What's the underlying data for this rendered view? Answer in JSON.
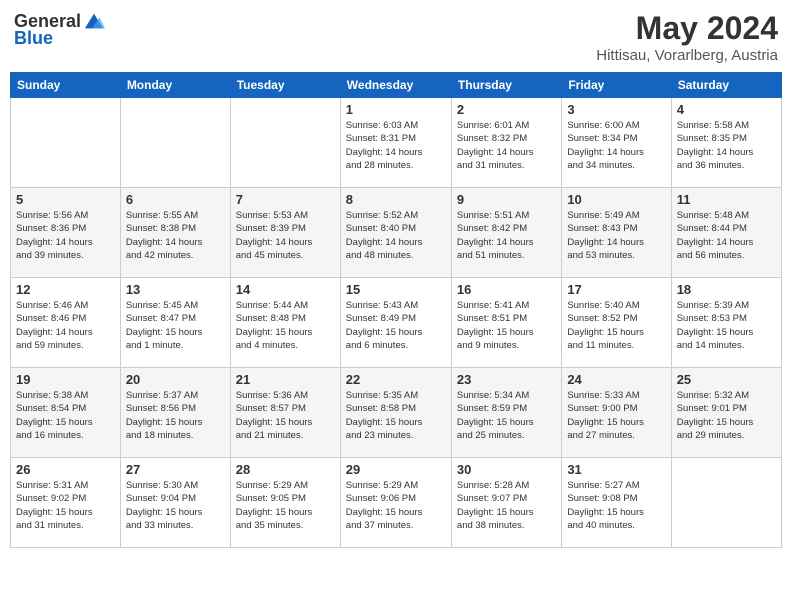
{
  "header": {
    "logo_line1": "General",
    "logo_line2": "Blue",
    "month_year": "May 2024",
    "location": "Hittisau, Vorarlberg, Austria"
  },
  "days_of_week": [
    "Sunday",
    "Monday",
    "Tuesday",
    "Wednesday",
    "Thursday",
    "Friday",
    "Saturday"
  ],
  "weeks": [
    [
      {
        "day": "",
        "info": ""
      },
      {
        "day": "",
        "info": ""
      },
      {
        "day": "",
        "info": ""
      },
      {
        "day": "1",
        "info": "Sunrise: 6:03 AM\nSunset: 8:31 PM\nDaylight: 14 hours\nand 28 minutes."
      },
      {
        "day": "2",
        "info": "Sunrise: 6:01 AM\nSunset: 8:32 PM\nDaylight: 14 hours\nand 31 minutes."
      },
      {
        "day": "3",
        "info": "Sunrise: 6:00 AM\nSunset: 8:34 PM\nDaylight: 14 hours\nand 34 minutes."
      },
      {
        "day": "4",
        "info": "Sunrise: 5:58 AM\nSunset: 8:35 PM\nDaylight: 14 hours\nand 36 minutes."
      }
    ],
    [
      {
        "day": "5",
        "info": "Sunrise: 5:56 AM\nSunset: 8:36 PM\nDaylight: 14 hours\nand 39 minutes."
      },
      {
        "day": "6",
        "info": "Sunrise: 5:55 AM\nSunset: 8:38 PM\nDaylight: 14 hours\nand 42 minutes."
      },
      {
        "day": "7",
        "info": "Sunrise: 5:53 AM\nSunset: 8:39 PM\nDaylight: 14 hours\nand 45 minutes."
      },
      {
        "day": "8",
        "info": "Sunrise: 5:52 AM\nSunset: 8:40 PM\nDaylight: 14 hours\nand 48 minutes."
      },
      {
        "day": "9",
        "info": "Sunrise: 5:51 AM\nSunset: 8:42 PM\nDaylight: 14 hours\nand 51 minutes."
      },
      {
        "day": "10",
        "info": "Sunrise: 5:49 AM\nSunset: 8:43 PM\nDaylight: 14 hours\nand 53 minutes."
      },
      {
        "day": "11",
        "info": "Sunrise: 5:48 AM\nSunset: 8:44 PM\nDaylight: 14 hours\nand 56 minutes."
      }
    ],
    [
      {
        "day": "12",
        "info": "Sunrise: 5:46 AM\nSunset: 8:46 PM\nDaylight: 14 hours\nand 59 minutes."
      },
      {
        "day": "13",
        "info": "Sunrise: 5:45 AM\nSunset: 8:47 PM\nDaylight: 15 hours\nand 1 minute."
      },
      {
        "day": "14",
        "info": "Sunrise: 5:44 AM\nSunset: 8:48 PM\nDaylight: 15 hours\nand 4 minutes."
      },
      {
        "day": "15",
        "info": "Sunrise: 5:43 AM\nSunset: 8:49 PM\nDaylight: 15 hours\nand 6 minutes."
      },
      {
        "day": "16",
        "info": "Sunrise: 5:41 AM\nSunset: 8:51 PM\nDaylight: 15 hours\nand 9 minutes."
      },
      {
        "day": "17",
        "info": "Sunrise: 5:40 AM\nSunset: 8:52 PM\nDaylight: 15 hours\nand 11 minutes."
      },
      {
        "day": "18",
        "info": "Sunrise: 5:39 AM\nSunset: 8:53 PM\nDaylight: 15 hours\nand 14 minutes."
      }
    ],
    [
      {
        "day": "19",
        "info": "Sunrise: 5:38 AM\nSunset: 8:54 PM\nDaylight: 15 hours\nand 16 minutes."
      },
      {
        "day": "20",
        "info": "Sunrise: 5:37 AM\nSunset: 8:56 PM\nDaylight: 15 hours\nand 18 minutes."
      },
      {
        "day": "21",
        "info": "Sunrise: 5:36 AM\nSunset: 8:57 PM\nDaylight: 15 hours\nand 21 minutes."
      },
      {
        "day": "22",
        "info": "Sunrise: 5:35 AM\nSunset: 8:58 PM\nDaylight: 15 hours\nand 23 minutes."
      },
      {
        "day": "23",
        "info": "Sunrise: 5:34 AM\nSunset: 8:59 PM\nDaylight: 15 hours\nand 25 minutes."
      },
      {
        "day": "24",
        "info": "Sunrise: 5:33 AM\nSunset: 9:00 PM\nDaylight: 15 hours\nand 27 minutes."
      },
      {
        "day": "25",
        "info": "Sunrise: 5:32 AM\nSunset: 9:01 PM\nDaylight: 15 hours\nand 29 minutes."
      }
    ],
    [
      {
        "day": "26",
        "info": "Sunrise: 5:31 AM\nSunset: 9:02 PM\nDaylight: 15 hours\nand 31 minutes."
      },
      {
        "day": "27",
        "info": "Sunrise: 5:30 AM\nSunset: 9:04 PM\nDaylight: 15 hours\nand 33 minutes."
      },
      {
        "day": "28",
        "info": "Sunrise: 5:29 AM\nSunset: 9:05 PM\nDaylight: 15 hours\nand 35 minutes."
      },
      {
        "day": "29",
        "info": "Sunrise: 5:29 AM\nSunset: 9:06 PM\nDaylight: 15 hours\nand 37 minutes."
      },
      {
        "day": "30",
        "info": "Sunrise: 5:28 AM\nSunset: 9:07 PM\nDaylight: 15 hours\nand 38 minutes."
      },
      {
        "day": "31",
        "info": "Sunrise: 5:27 AM\nSunset: 9:08 PM\nDaylight: 15 hours\nand 40 minutes."
      },
      {
        "day": "",
        "info": ""
      }
    ]
  ]
}
